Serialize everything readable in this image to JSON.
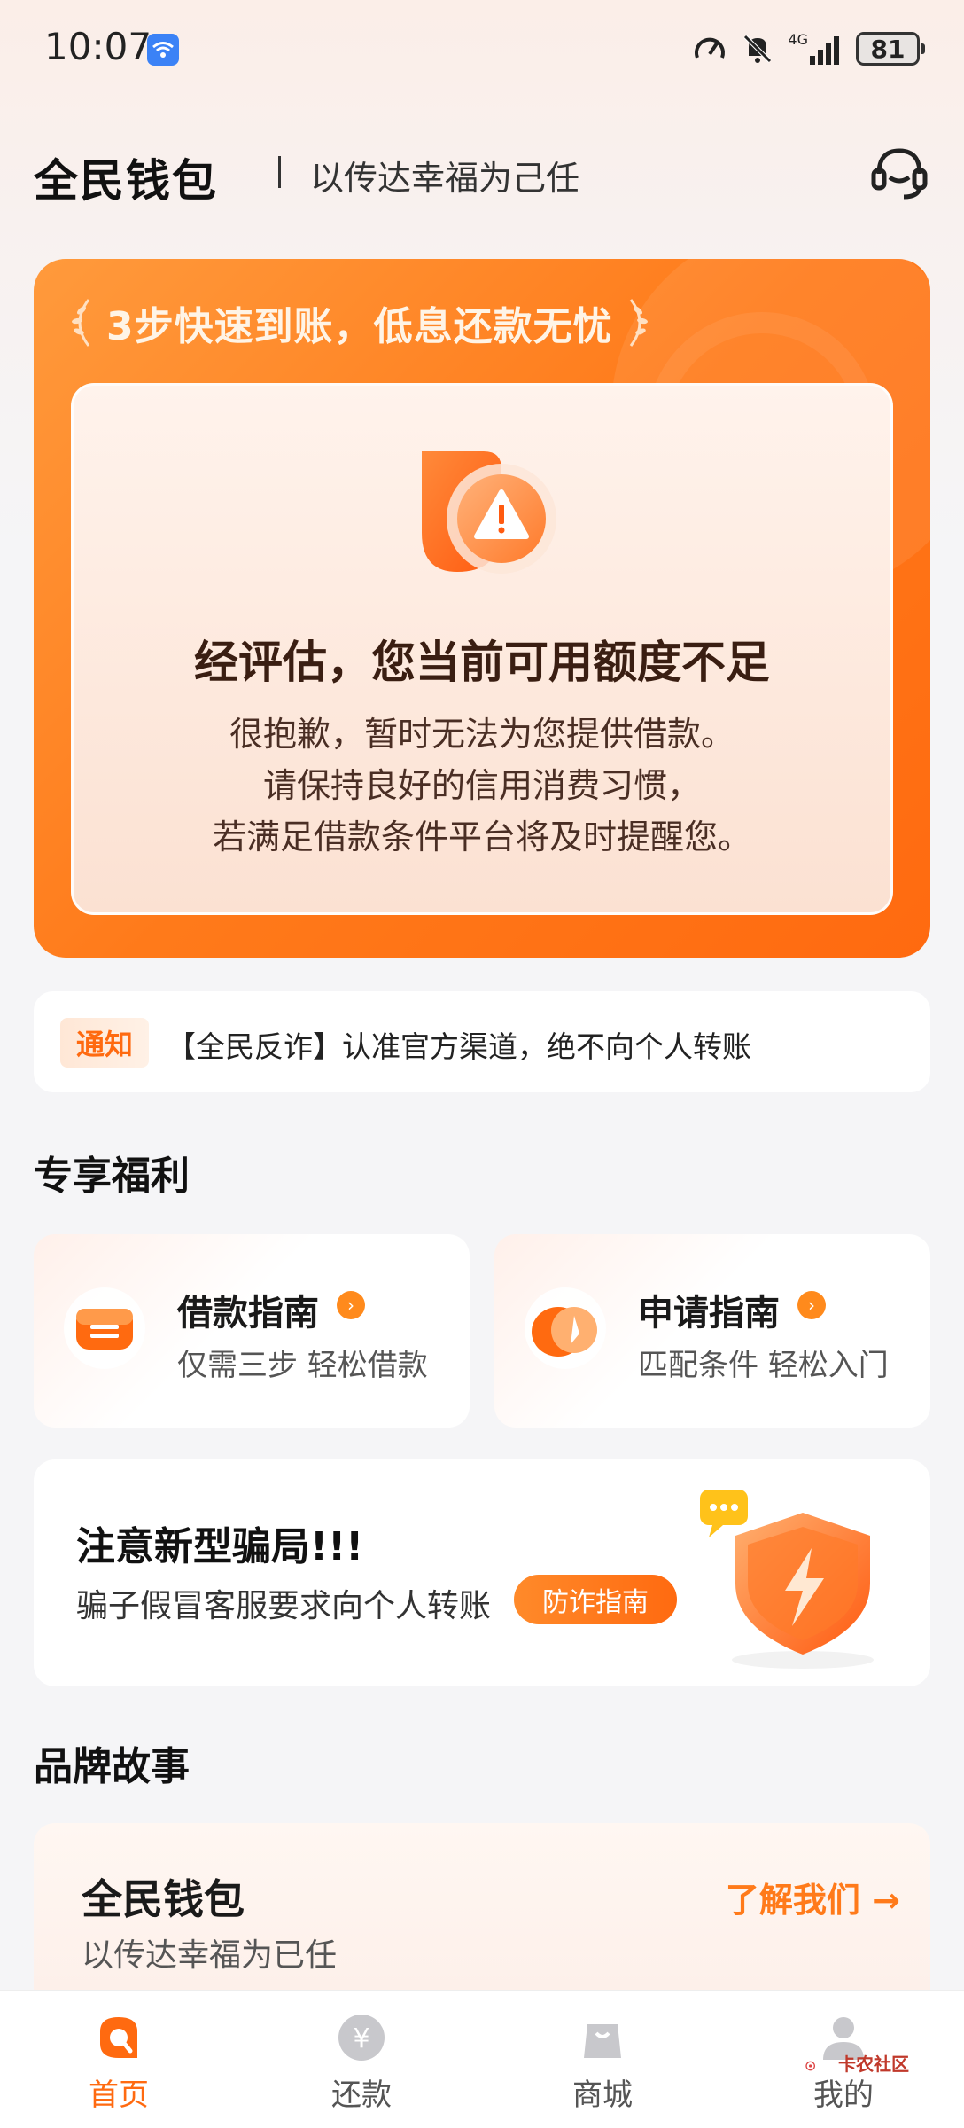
{
  "status_bar": {
    "time": "10:07",
    "network": "4G",
    "battery": "81"
  },
  "header": {
    "brand": "全民钱包",
    "slogan": "以传达幸福为己任"
  },
  "hero": {
    "title": "3步快速到账，低息还款无忧",
    "assessment_title": "经评估，您当前可用额度不足",
    "message_lines": [
      "很抱歉，暂时无法为您提供借款。",
      "请保持良好的信用消费习惯，",
      "若满足借款条件平台将及时提醒您。"
    ]
  },
  "notice": {
    "tag": "通知",
    "text": "【全民反诈】认准官方渠道，绝不向个人转账"
  },
  "benefits": {
    "section_title": "专享福利",
    "items": [
      {
        "title": "借款指南",
        "subtitle": "仅需三步 轻松借款"
      },
      {
        "title": "申请指南",
        "subtitle": "匹配条件 轻松入门"
      }
    ]
  },
  "fraud": {
    "title": "注意新型骗局!!!",
    "subtitle": "骗子假冒客服要求向个人转账",
    "button_label": "防诈指南"
  },
  "story": {
    "section_title": "品牌故事",
    "title": "全民钱包",
    "subtitle": "以传达幸福为已任",
    "link_label": "了解我们 →"
  },
  "tabbar": {
    "items": [
      {
        "label": "首页"
      },
      {
        "label": "还款"
      },
      {
        "label": "商城"
      },
      {
        "label": "我的"
      }
    ]
  },
  "watermark": "卡农社区",
  "colors": {
    "accent": "#ff7a1a",
    "accent_dark": "#ff6a10"
  }
}
